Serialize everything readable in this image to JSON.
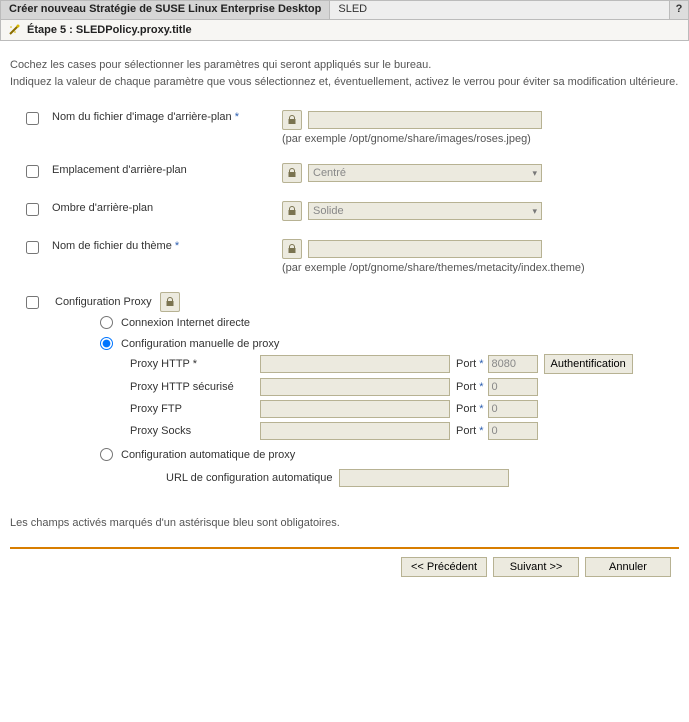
{
  "titlebar": {
    "main": "Créer nouveau Stratégie de SUSE Linux Enterprise Desktop",
    "sub": "SLED",
    "help": "?"
  },
  "step": {
    "title": "Étape 5 : SLEDPolicy.proxy.title"
  },
  "intro": {
    "line1": "Cochez les cases pour sélectionner les paramètres qui seront appliqués sur le bureau.",
    "line2": "Indiquez la valeur de chaque paramètre que vous sélectionnez et, éventuellement, activez le verrou pour éviter sa modification ultérieure."
  },
  "fields": {
    "bg_image": {
      "label": "Nom du fichier d'image d'arrière-plan",
      "required": true,
      "hint": "(par exemple /opt/gnome/share/images/roses.jpeg)"
    },
    "bg_placement": {
      "label": "Emplacement d'arrière-plan",
      "value": "Centré"
    },
    "bg_shade": {
      "label": "Ombre d'arrière-plan",
      "value": "Solide"
    },
    "theme_file": {
      "label": "Nom de fichier du thème",
      "required": true,
      "hint": "(par exemple /opt/gnome/share/themes/metacity/index.theme)"
    }
  },
  "proxy": {
    "section_label": "Configuration Proxy",
    "radios": {
      "direct": "Connexion Internet directe",
      "manual": "Configuration manuelle de proxy",
      "auto": "Configuration automatique de proxy"
    },
    "port_label": "Port",
    "rows": {
      "http": {
        "label": "Proxy HTTP",
        "required": true,
        "port": "8080"
      },
      "https": {
        "label": "Proxy HTTP sécurisé",
        "port": "0"
      },
      "ftp": {
        "label": "Proxy FTP",
        "port": "0"
      },
      "socks": {
        "label": "Proxy Socks",
        "port": "0"
      }
    },
    "auth_button": "Authentification",
    "auto_url_label": "URL de configuration automatique"
  },
  "footnote": "Les champs activés marqués d'un astérisque bleu sont obligatoires.",
  "footer": {
    "prev": "<< Précédent",
    "next": "Suivant >>",
    "cancel": "Annuler"
  },
  "asterisk": "*"
}
